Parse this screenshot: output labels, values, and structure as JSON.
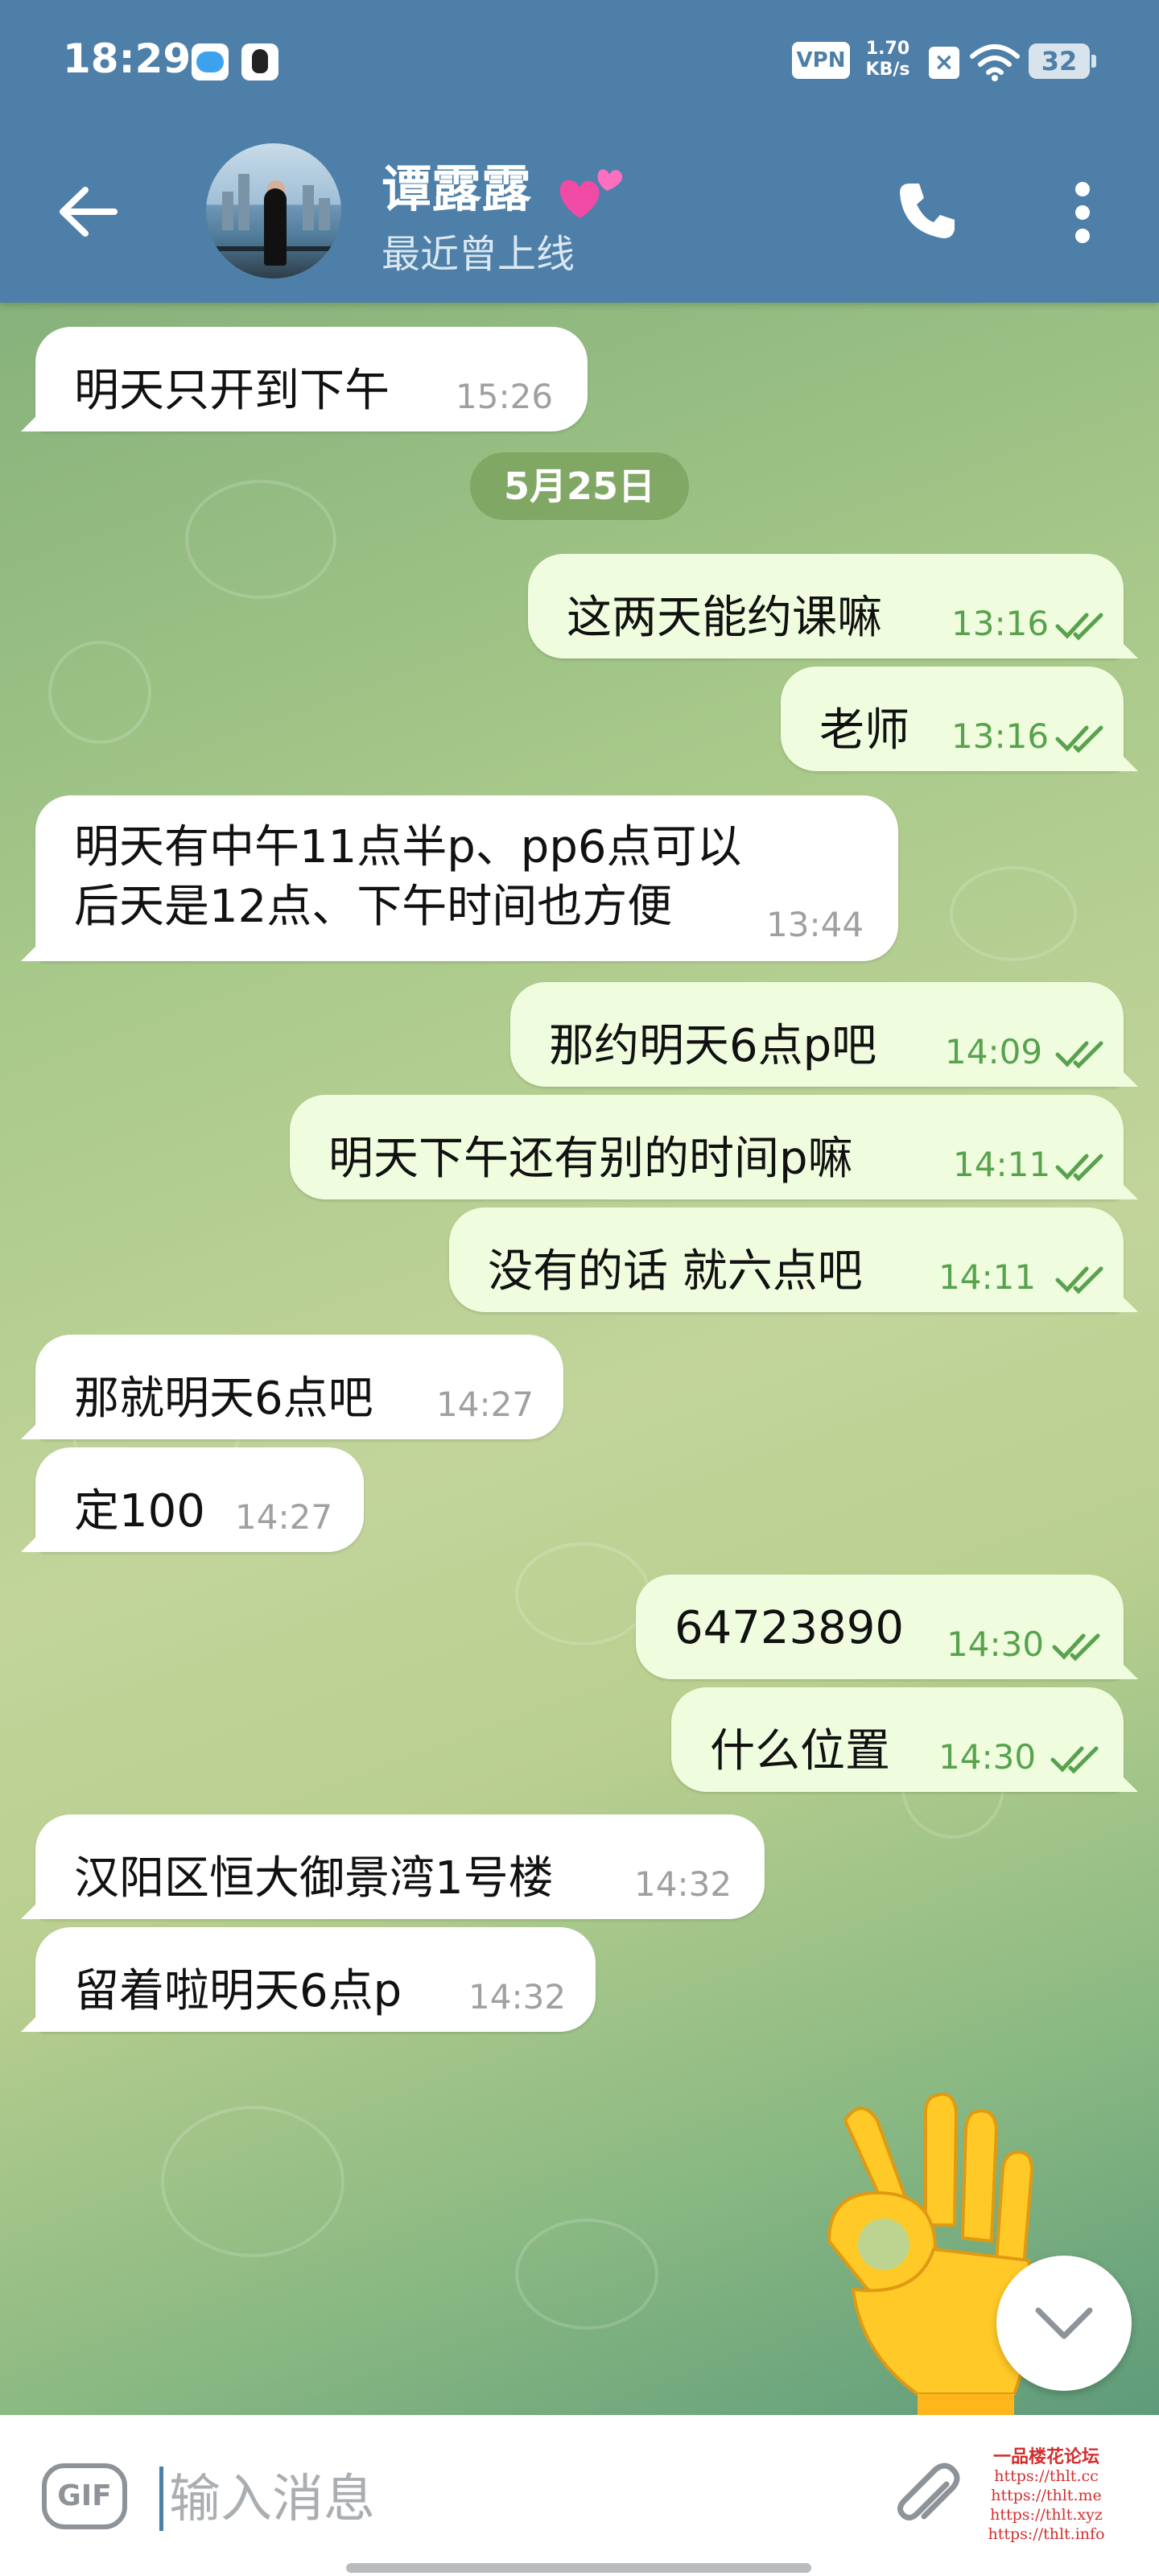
{
  "status_bar": {
    "time": "18:29",
    "vpn": "VPN",
    "speed_value": "1.70",
    "speed_unit": "KB/s",
    "battery": "32"
  },
  "header": {
    "name": "谭露露",
    "status": "最近曾上线"
  },
  "date_separator": "5月25日",
  "messages": [
    {
      "side": "in",
      "text": "明天只开到下午",
      "time": "15:26"
    },
    {
      "side": "out",
      "text": "这两天能约课嘛",
      "time": "13:16"
    },
    {
      "side": "out",
      "text": "老师",
      "time": "13:16"
    },
    {
      "side": "in",
      "text": "明天有中午11点半p、pp6点可以\n后天是12点、下午时间也方便",
      "time": "13:44"
    },
    {
      "side": "out",
      "text": "那约明天6点p吧",
      "time": "14:09"
    },
    {
      "side": "out",
      "text": "明天下午还有别的时间p嘛",
      "time": "14:11"
    },
    {
      "side": "out",
      "text": "没有的话 就六点吧",
      "time": "14:11"
    },
    {
      "side": "in",
      "text": "那就明天6点吧",
      "time": "14:27"
    },
    {
      "side": "in",
      "text": "定100",
      "time": "14:27"
    },
    {
      "side": "out",
      "text": "64723890",
      "time": "14:30"
    },
    {
      "side": "out",
      "text": "什么位置",
      "time": "14:30"
    },
    {
      "side": "in",
      "text": "汉阳区恒大御景湾1号楼",
      "time": "14:32"
    },
    {
      "side": "in",
      "text": "留着啦明天6点p",
      "time": "14:32"
    }
  ],
  "input": {
    "placeholder": "输入消息",
    "gif_label": "GIF"
  },
  "watermark": {
    "title": "一品楼花论坛",
    "lines": [
      "https://thlt.cc",
      "https://thlt.me",
      "https://thlt.xyz",
      "https://thlt.info"
    ]
  },
  "colors": {
    "header": "#4d7fa8",
    "outgoing_bubble": "#effdde",
    "incoming_bubble": "#ffffff",
    "read_ticks": "#58a24e"
  },
  "icons": [
    "back-arrow-icon",
    "phone-icon",
    "more-vert-icon",
    "double-check-icon",
    "ok-hand-emoji",
    "chevron-down-icon",
    "gif-icon",
    "paperclip-icon"
  ]
}
